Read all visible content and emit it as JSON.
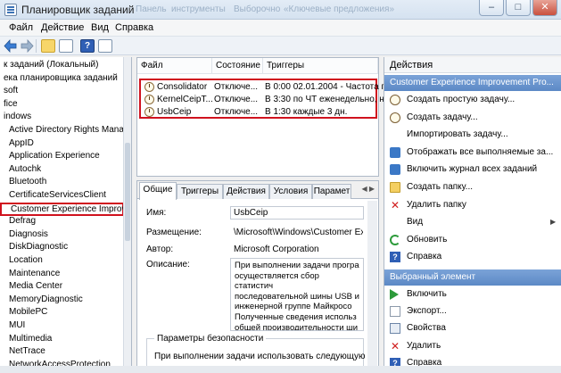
{
  "window": {
    "title": "Планировщик заданий",
    "ghost_titles": [
      "Панель",
      "инструменты",
      "Выборочно",
      "«Ключевые предложения»"
    ],
    "controls": [
      "–",
      "□",
      "✕"
    ]
  },
  "menu": [
    "Файл",
    "Действие",
    "Вид",
    "Справка"
  ],
  "toolbar": {
    "help_glyph": "?"
  },
  "tree": [
    "к заданий (Локальный)",
    "ека планировщика заданий",
    "soft",
    "fice",
    "indows",
    "Active Directory Rights Mana",
    "AppID",
    "Application Experience",
    "Autochk",
    "Bluetooth",
    "CertificateServicesClient",
    "Customer Experience Improv",
    "Defrag",
    "Diagnosis",
    "DiskDiagnostic",
    "Location",
    "Maintenance",
    "Media Center",
    "MemoryDiagnostic",
    "MobilePC",
    "MUI",
    "Multimedia",
    "NetTrace",
    "NetworkAccessProtection"
  ],
  "tasklist": {
    "columns": [
      "Файл",
      "Состояние",
      "Триггеры"
    ],
    "rows": [
      {
        "name": "Consolidator",
        "state": "Отключе...",
        "trigger": "В 0:00 02.01.2004 - Частота п"
      },
      {
        "name": "KernelCeipT...",
        "state": "Отключе...",
        "trigger": "В 3:30 по ЧТ еженедельно, на"
      },
      {
        "name": "UsbCeip",
        "state": "Отключе...",
        "trigger": "В 1:30 каждые 3 дн."
      }
    ]
  },
  "props": {
    "tabs": [
      "Общие",
      "Триггеры",
      "Действия",
      "Условия",
      "Парамет"
    ],
    "tab_arrows": "◀ ▶",
    "name_label": "Имя:",
    "name_value": "UsbCeip",
    "location_label": "Размещение:",
    "location_value": "\\Microsoft\\Windows\\Customer Ex",
    "author_label": "Автор:",
    "author_value": "Microsoft Corporation",
    "desc_label": "Описание:",
    "desc_lines": [
      "При выполнении задачи програ",
      "осуществляется сбор статистич",
      "последовательной шины USB и",
      "инженерной группе Майкросо",
      "Полученные сведения использ",
      "общей производительности ши"
    ],
    "security_title": "Параметры безопасности",
    "security_text": "При выполнении задачи использовать следующую у"
  },
  "actions": {
    "header": "Действия",
    "group1": "Customer Experience Improvement Pro...",
    "group1_items": [
      {
        "label": "Создать простую задачу...",
        "icon": "clock-icon"
      },
      {
        "label": "Создать задачу...",
        "icon": "clock-icon"
      },
      {
        "label": "Импортировать задачу...",
        "icon": "blank-icon"
      },
      {
        "label": "Отображать все выполняемые за...",
        "icon": "flag-icon"
      },
      {
        "label": "Включить журнал всех заданий",
        "icon": "flag-icon"
      },
      {
        "label": "Создать папку...",
        "icon": "folder-icon"
      },
      {
        "label": "Удалить папку",
        "icon": "delete-icon"
      },
      {
        "label": "Вид",
        "icon": "blank-icon"
      },
      {
        "label": "Обновить",
        "icon": "refresh-icon"
      },
      {
        "label": "Справка",
        "icon": "help-icon"
      }
    ],
    "group2": "Выбранный элемент",
    "group2_items": [
      {
        "label": "Включить",
        "icon": "play-icon"
      },
      {
        "label": "Экспорт...",
        "icon": "export-icon"
      },
      {
        "label": "Свойства",
        "icon": "properties-icon"
      },
      {
        "label": "Удалить",
        "icon": "delete-icon"
      },
      {
        "label": "Справка",
        "icon": "help-icon"
      }
    ],
    "submenu_arrow": "▶"
  },
  "colors": {
    "highlight_red": "#d0121e",
    "group_blue": "#5c89c6"
  }
}
